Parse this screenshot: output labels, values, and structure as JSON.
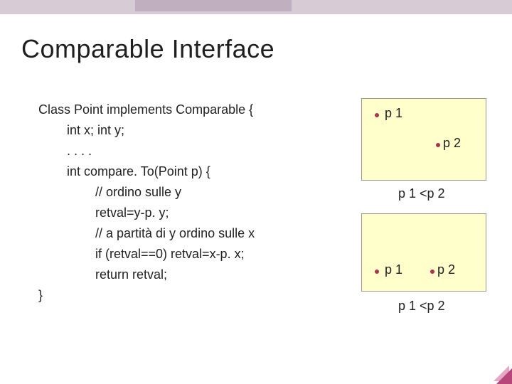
{
  "title": "Comparable Interface",
  "code": {
    "l0": "Class Point implements Comparable {",
    "l1": "int x; int y;",
    "l2": ". . . .",
    "l3": "int compare. To(Point p) {",
    "l4": "// ordino sulle y",
    "l5": "retval=y-p. y;",
    "l6": "// a partità di y ordino sulle x",
    "l7": "if (retval==0) retval=x-p. x;",
    "l8": "return retval;",
    "l9": "}"
  },
  "diagram": {
    "p1": "p 1",
    "p2": "p 2",
    "rel1": "p 1 <p 2",
    "rel2": "p 1 <p 2"
  }
}
